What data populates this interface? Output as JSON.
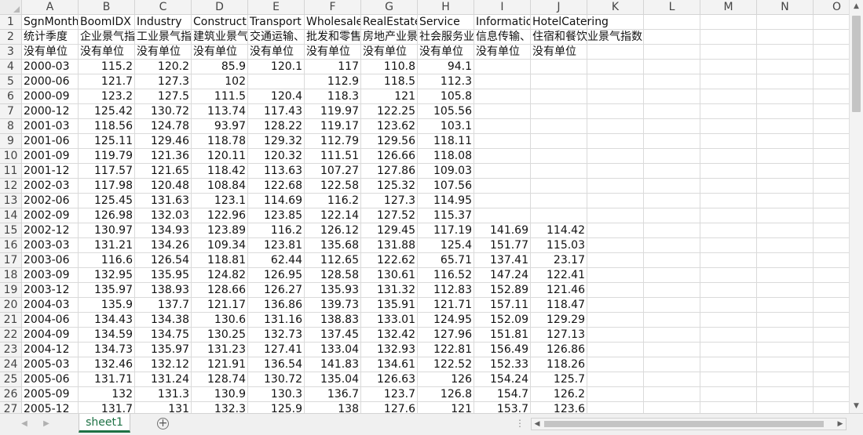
{
  "sheet": {
    "columns": [
      "A",
      "B",
      "C",
      "D",
      "E",
      "F",
      "G",
      "H",
      "I",
      "J",
      "K",
      "L",
      "M",
      "N",
      "O"
    ],
    "header_rows": [
      {
        "row": "1",
        "cells": [
          "SgnMonth",
          "BoomIDX",
          "Industry",
          "Constructio",
          "Transport",
          "Wholesale",
          "RealEstate",
          "Service",
          "Informatio",
          "HotelCatering",
          "",
          "",
          "",
          "",
          ""
        ]
      },
      {
        "row": "2",
        "cells": [
          "统计季度",
          "企业景气指",
          "工业景气指",
          "建筑业景气",
          "交通运输、",
          "批发和零售",
          "房地产业景",
          "社会服务业",
          "信息传输、",
          "住宿和餐饮业景气指数",
          "",
          "",
          "",
          "",
          ""
        ]
      },
      {
        "row": "3",
        "cells": [
          "没有单位",
          "没有单位",
          "没有单位",
          "没有单位",
          "没有单位",
          "没有单位",
          "没有单位",
          "没有单位",
          "没有单位",
          "没有单位",
          "",
          "",
          "",
          "",
          ""
        ]
      }
    ],
    "data_rows": [
      {
        "row": "4",
        "cells": [
          "2000-03",
          "115.2",
          "120.2",
          "85.9",
          "120.1",
          "117",
          "110.8",
          "94.1",
          "",
          "",
          "",
          "",
          "",
          "",
          ""
        ]
      },
      {
        "row": "5",
        "cells": [
          "2000-06",
          "121.7",
          "127.3",
          "102",
          "",
          "112.9",
          "118.5",
          "112.3",
          "",
          "",
          "",
          "",
          "",
          "",
          ""
        ]
      },
      {
        "row": "6",
        "cells": [
          "2000-09",
          "123.2",
          "127.5",
          "111.5",
          "120.4",
          "118.3",
          "121",
          "105.8",
          "",
          "",
          "",
          "",
          "",
          "",
          ""
        ]
      },
      {
        "row": "7",
        "cells": [
          "2000-12",
          "125.42",
          "130.72",
          "113.74",
          "117.43",
          "119.97",
          "122.25",
          "105.56",
          "",
          "",
          "",
          "",
          "",
          "",
          ""
        ]
      },
      {
        "row": "8",
        "cells": [
          "2001-03",
          "118.56",
          "124.78",
          "93.97",
          "128.22",
          "119.17",
          "123.62",
          "103.1",
          "",
          "",
          "",
          "",
          "",
          "",
          ""
        ]
      },
      {
        "row": "9",
        "cells": [
          "2001-06",
          "125.11",
          "129.46",
          "118.78",
          "129.32",
          "112.79",
          "129.56",
          "118.11",
          "",
          "",
          "",
          "",
          "",
          "",
          ""
        ]
      },
      {
        "row": "10",
        "cells": [
          "2001-09",
          "119.79",
          "121.36",
          "120.11",
          "120.32",
          "111.51",
          "126.66",
          "118.08",
          "",
          "",
          "",
          "",
          "",
          "",
          ""
        ]
      },
      {
        "row": "11",
        "cells": [
          "2001-12",
          "117.57",
          "121.65",
          "118.42",
          "113.63",
          "107.27",
          "127.86",
          "109.03",
          "",
          "",
          "",
          "",
          "",
          "",
          ""
        ]
      },
      {
        "row": "12",
        "cells": [
          "2002-03",
          "117.98",
          "120.48",
          "108.84",
          "122.68",
          "122.58",
          "125.32",
          "107.56",
          "",
          "",
          "",
          "",
          "",
          "",
          ""
        ]
      },
      {
        "row": "13",
        "cells": [
          "2002-06",
          "125.45",
          "131.63",
          "123.1",
          "114.69",
          "116.2",
          "127.3",
          "114.95",
          "",
          "",
          "",
          "",
          "",
          "",
          ""
        ]
      },
      {
        "row": "14",
        "cells": [
          "2002-09",
          "126.98",
          "132.03",
          "122.96",
          "123.85",
          "122.14",
          "127.52",
          "115.37",
          "",
          "",
          "",
          "",
          "",
          "",
          ""
        ]
      },
      {
        "row": "15",
        "cells": [
          "2002-12",
          "130.97",
          "134.93",
          "123.89",
          "116.2",
          "126.12",
          "129.45",
          "117.19",
          "141.69",
          "114.42",
          "",
          "",
          "",
          "",
          ""
        ]
      },
      {
        "row": "16",
        "cells": [
          "2003-03",
          "131.21",
          "134.26",
          "109.34",
          "123.81",
          "135.68",
          "131.88",
          "125.4",
          "151.77",
          "115.03",
          "",
          "",
          "",
          "",
          ""
        ]
      },
      {
        "row": "17",
        "cells": [
          "2003-06",
          "116.6",
          "126.54",
          "118.81",
          "62.44",
          "112.65",
          "122.62",
          "65.71",
          "137.41",
          "23.17",
          "",
          "",
          "",
          "",
          ""
        ]
      },
      {
        "row": "18",
        "cells": [
          "2003-09",
          "132.95",
          "135.95",
          "124.82",
          "126.95",
          "128.58",
          "130.61",
          "116.52",
          "147.24",
          "122.41",
          "",
          "",
          "",
          "",
          ""
        ]
      },
      {
        "row": "19",
        "cells": [
          "2003-12",
          "135.97",
          "138.93",
          "128.66",
          "126.27",
          "135.93",
          "131.32",
          "112.83",
          "152.89",
          "121.46",
          "",
          "",
          "",
          "",
          ""
        ]
      },
      {
        "row": "20",
        "cells": [
          "2004-03",
          "135.9",
          "137.7",
          "121.17",
          "136.86",
          "139.73",
          "135.91",
          "121.71",
          "157.11",
          "118.47",
          "",
          "",
          "",
          "",
          ""
        ]
      },
      {
        "row": "21",
        "cells": [
          "2004-06",
          "134.43",
          "134.38",
          "130.6",
          "131.16",
          "138.83",
          "133.01",
          "124.95",
          "152.09",
          "129.29",
          "",
          "",
          "",
          "",
          ""
        ]
      },
      {
        "row": "22",
        "cells": [
          "2004-09",
          "134.59",
          "134.75",
          "130.25",
          "132.73",
          "137.45",
          "132.42",
          "127.96",
          "151.81",
          "127.13",
          "",
          "",
          "",
          "",
          ""
        ]
      },
      {
        "row": "23",
        "cells": [
          "2004-12",
          "134.73",
          "135.97",
          "131.23",
          "127.41",
          "133.04",
          "132.93",
          "122.81",
          "156.49",
          "126.86",
          "",
          "",
          "",
          "",
          ""
        ]
      },
      {
        "row": "24",
        "cells": [
          "2005-03",
          "132.46",
          "132.12",
          "121.91",
          "136.54",
          "141.83",
          "134.61",
          "122.52",
          "152.33",
          "118.26",
          "",
          "",
          "",
          "",
          ""
        ]
      },
      {
        "row": "25",
        "cells": [
          "2005-06",
          "131.71",
          "131.24",
          "128.74",
          "130.72",
          "135.04",
          "126.63",
          "126",
          "154.24",
          "125.7",
          "",
          "",
          "",
          "",
          ""
        ]
      },
      {
        "row": "26",
        "cells": [
          "2005-09",
          "132",
          "131.3",
          "130.9",
          "130.3",
          "136.7",
          "123.7",
          "126.8",
          "154.7",
          "126.2",
          "",
          "",
          "",
          "",
          ""
        ]
      },
      {
        "row": "27",
        "cells": [
          "2005-12",
          "131.7",
          "131",
          "132.3",
          "125.9",
          "138",
          "127.6",
          "121",
          "153.7",
          "123.6",
          "",
          "",
          "",
          "",
          ""
        ]
      }
    ]
  },
  "tabs": {
    "active": "sheet1",
    "add_label": "+"
  },
  "scroll": {
    "up": "▲",
    "down": "▼",
    "left": "◀",
    "right": "▶",
    "prev_sheet": "◀",
    "next_sheet": "▶",
    "more": "⋮"
  }
}
